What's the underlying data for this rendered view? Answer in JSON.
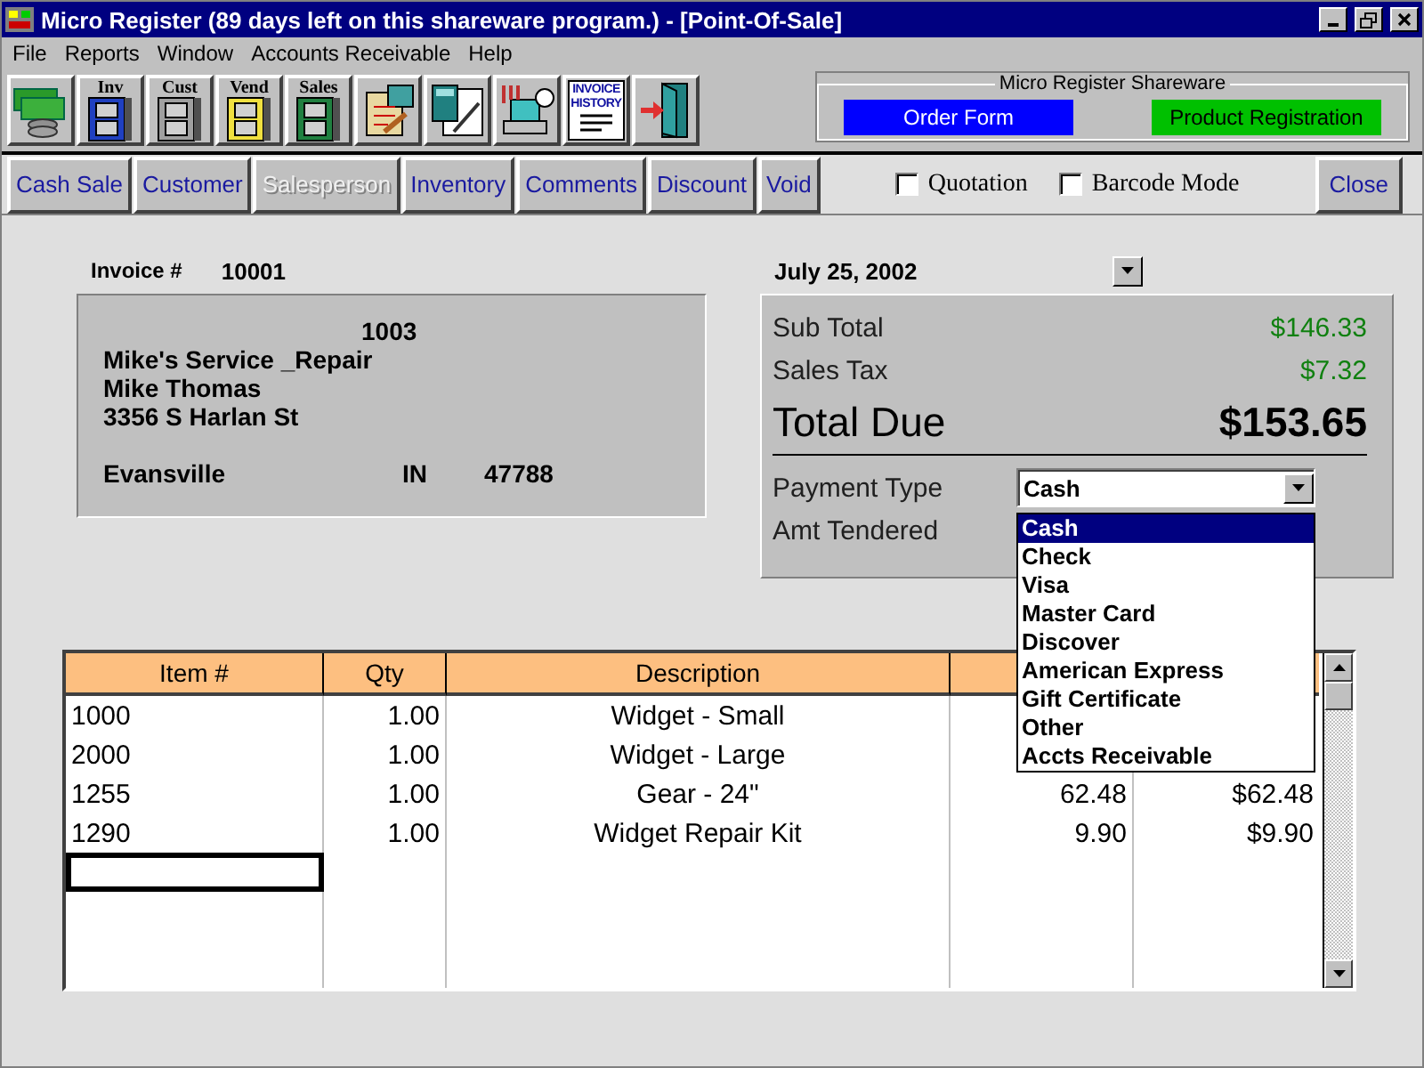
{
  "window": {
    "title": "Micro Register (89 days left on this shareware program.) - [Point-Of-Sale]"
  },
  "menu": [
    "File",
    "Reports",
    "Window",
    "Accounts Receivable",
    "Help"
  ],
  "toolbar": [
    {
      "kind": "money"
    },
    {
      "kind": "cabinet",
      "label": "Inv",
      "color": "#2040c0"
    },
    {
      "kind": "cabinet",
      "label": "Cust",
      "color": "#a0a0a0"
    },
    {
      "kind": "cabinet",
      "label": "Vend",
      "color": "#f0e040"
    },
    {
      "kind": "cabinet",
      "label": "Sales",
      "color": "#208040"
    },
    {
      "kind": "clipboard"
    },
    {
      "kind": "calculator"
    },
    {
      "kind": "computer"
    },
    {
      "kind": "document",
      "label": "INVOICE HISTORY"
    },
    {
      "kind": "door"
    }
  ],
  "shareware": {
    "title": "Micro Register Shareware",
    "buttons": [
      {
        "label": "Order Form",
        "color": "#0000ff"
      },
      {
        "label": "Product Registration",
        "color": "#00c000"
      }
    ]
  },
  "actions": [
    {
      "label": "Cash Sale",
      "disabled": false
    },
    {
      "label": "Customer",
      "disabled": false
    },
    {
      "label": "Salesperson",
      "disabled": true
    },
    {
      "label": "Inventory",
      "disabled": false
    },
    {
      "label": "Comments",
      "disabled": false
    },
    {
      "label": "Discount",
      "disabled": false
    },
    {
      "label": "Void",
      "disabled": false
    }
  ],
  "options": [
    {
      "label": "Quotation",
      "checked": false
    },
    {
      "label": "Barcode Mode",
      "checked": false
    }
  ],
  "close_button": "Close",
  "invoice": {
    "label": "Invoice #",
    "number": "10001",
    "date": "July 25, 2002"
  },
  "customer": {
    "id": "1003",
    "name": "Mike's Service _Repair",
    "contact": "Mike Thomas",
    "street": "3356 S Harlan St",
    "city": "Evansville",
    "state": "IN",
    "zip": "47788"
  },
  "totals": {
    "sub_total_label": "Sub Total",
    "sub_total": "$146.33",
    "tax_label": "Sales Tax",
    "tax": "$7.32",
    "total_label": "Total Due",
    "total": "$153.65",
    "payment_label": "Payment Type",
    "payment_value": "Cash",
    "tendered_label": "Amt Tendered"
  },
  "payment_options": [
    {
      "label": "Cash",
      "selected": true
    },
    {
      "label": "Check",
      "selected": false
    },
    {
      "label": "Visa",
      "selected": false
    },
    {
      "label": "Master Card",
      "selected": false
    },
    {
      "label": "Discover",
      "selected": false
    },
    {
      "label": "American Express",
      "selected": false
    },
    {
      "label": "Gift Certificate",
      "selected": false
    },
    {
      "label": "Other",
      "selected": false
    },
    {
      "label": "Accts Receivable",
      "selected": false
    }
  ],
  "table": {
    "columns": [
      "Item #",
      "Qty",
      "Description"
    ],
    "rows": [
      {
        "item": "1000",
        "qty": "1.00",
        "description": "Widget - Small"
      },
      {
        "item": "2000",
        "qty": "1.00",
        "description": "Widget - Large"
      },
      {
        "item": "1255",
        "qty": "1.00",
        "description": "Gear - 24\"",
        "price": "62.48",
        "amount": "$62.48"
      },
      {
        "item": "1290",
        "qty": "1.00",
        "description": "Widget Repair Kit",
        "price": "9.90",
        "amount": "$9.90"
      }
    ],
    "entry_cell": {
      "focused": true
    }
  }
}
